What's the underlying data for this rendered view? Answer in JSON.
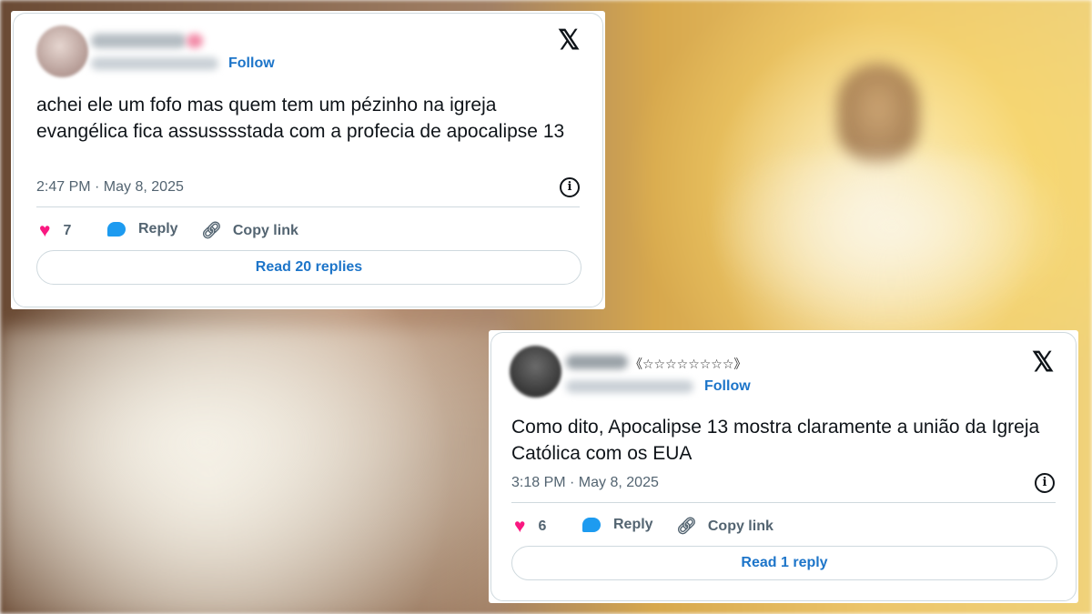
{
  "tweets": [
    {
      "follow_label": "Follow",
      "text": "achei ele um fofo mas quem tem um pézinho na igreja evangélica fica assusssstada com a profecia de apocalipse 13",
      "timestamp": "2:47 PM · May 8, 2025",
      "likes": "7",
      "reply_label": "Reply",
      "copy_label": "Copy link",
      "read_label": "Read 20 replies"
    },
    {
      "name_suffix": "《☆☆☆☆☆☆☆☆》",
      "follow_label": "Follow",
      "text": "Como dito, Apocalipse 13 mostra claramente a união da Igreja Católica com os EUA",
      "timestamp": "3:18 PM · May 8, 2025",
      "likes": "6",
      "reply_label": "Reply",
      "copy_label": "Copy link",
      "read_label": "Read 1 reply"
    }
  ],
  "icons": {
    "platform_logo": "x-logo-icon",
    "like": "heart-icon",
    "reply": "speech-bubble-icon",
    "copy": "link-icon",
    "info": "info-icon"
  },
  "colors": {
    "accent": "#1d75c9",
    "like": "#f91880",
    "reply": "#1d9bf0",
    "text": "#0f1419",
    "muted": "#536471"
  }
}
